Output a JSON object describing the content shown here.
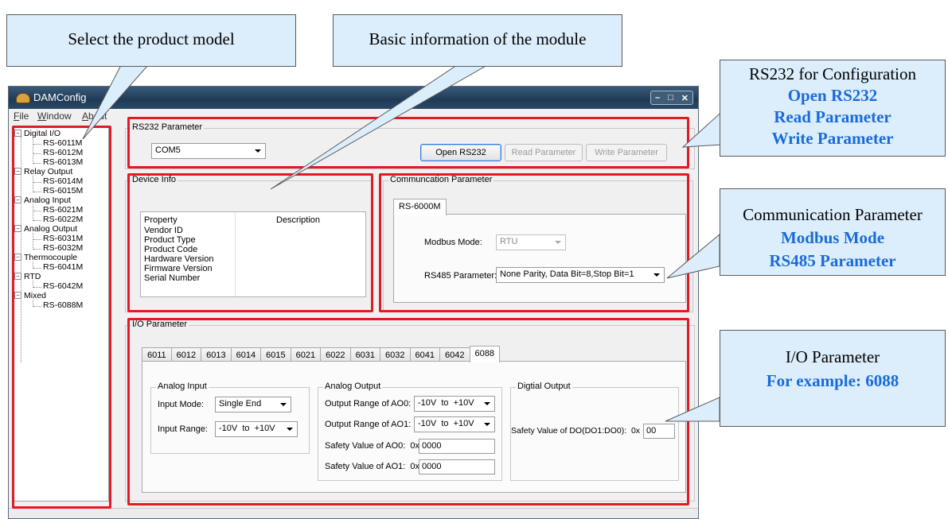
{
  "window": {
    "title": "DAMConfig",
    "menu": [
      "File",
      "Window",
      "About"
    ]
  },
  "tree": [
    {
      "group": "Digital I/O",
      "items": [
        "RS-6011M",
        "RS-6012M",
        "RS-6013M"
      ]
    },
    {
      "group": "Relay Output",
      "items": [
        "RS-6014M",
        "RS-6015M"
      ]
    },
    {
      "group": "Analog Input",
      "items": [
        "RS-6021M",
        "RS-6022M"
      ]
    },
    {
      "group": "Analog Output",
      "items": [
        "RS-6031M",
        "RS-6032M"
      ]
    },
    {
      "group": "Thermocouple",
      "items": [
        "RS-6041M"
      ]
    },
    {
      "group": "RTD",
      "items": [
        "RS-6042M"
      ]
    },
    {
      "group": "Mixed",
      "items": [
        "RS-6088M"
      ]
    }
  ],
  "rs232": {
    "group_label": "RS232 Parameter",
    "port": "COM5",
    "open_button": "Open RS232",
    "read_button": "Read Parameter",
    "write_button": "Write Parameter"
  },
  "device_info": {
    "group_label": "Device Info",
    "headers": [
      "Property",
      "Description"
    ],
    "rows": [
      "Vendor ID",
      "Product Type",
      "Product Code",
      "Hardware Version",
      "Firmware Version",
      "Serial Number"
    ]
  },
  "comm": {
    "group_label": "Communcation Parameter",
    "tab": "RS-6000M",
    "modbus_label": "Modbus Mode:",
    "modbus_value": "RTU",
    "rs485_label": "RS485 Parameter:",
    "rs485_value": "None Parity, Data Bit=8,Stop Bit=1"
  },
  "io": {
    "group_label": "I/O Parameter",
    "tabs": [
      "6011",
      "6012",
      "6013",
      "6014",
      "6015",
      "6021",
      "6022",
      "6031",
      "6032",
      "6041",
      "6042",
      "6088"
    ],
    "active_tab": "6088",
    "analog_input": {
      "label": "Analog Input",
      "mode_label": "Input Mode:",
      "mode_value": "Single End",
      "range_label": "Input Range:",
      "range_value": "-10V  to  +10V"
    },
    "analog_output": {
      "label": "Analog Output",
      "range0_label": "Output Range of AO0:",
      "range0_value": "-10V  to  +10V",
      "range1_label": "Output Range of AO1:",
      "range1_value": "-10V  to  +10V",
      "safety0_label": "Safety Value of AO0:  0x",
      "safety0_value": "0000",
      "safety1_label": "Safety Value of AO1:  0x",
      "safety1_value": "0000"
    },
    "digital_output": {
      "label": "Digtial Output",
      "safety_label": "Safety Value of DO(DO1:DO0):  0x",
      "safety_value": "00"
    }
  },
  "callouts": {
    "product_model": "Select the product model",
    "basic_info": "Basic information of the module",
    "rs232": {
      "title": "RS232 for Configuration",
      "lines": [
        "Open RS232",
        "Read Parameter",
        "Write Parameter"
      ]
    },
    "comm": {
      "title": "Communication Parameter",
      "lines": [
        "Modbus Mode",
        "RS485 Parameter"
      ]
    },
    "io": {
      "title": "I/O Parameter",
      "lines": [
        "For example: 6088"
      ]
    }
  },
  "colors": {
    "highlight": "#e01b24",
    "callout_fill": "#dceefc",
    "callout_bold": "#1a6bd8"
  }
}
